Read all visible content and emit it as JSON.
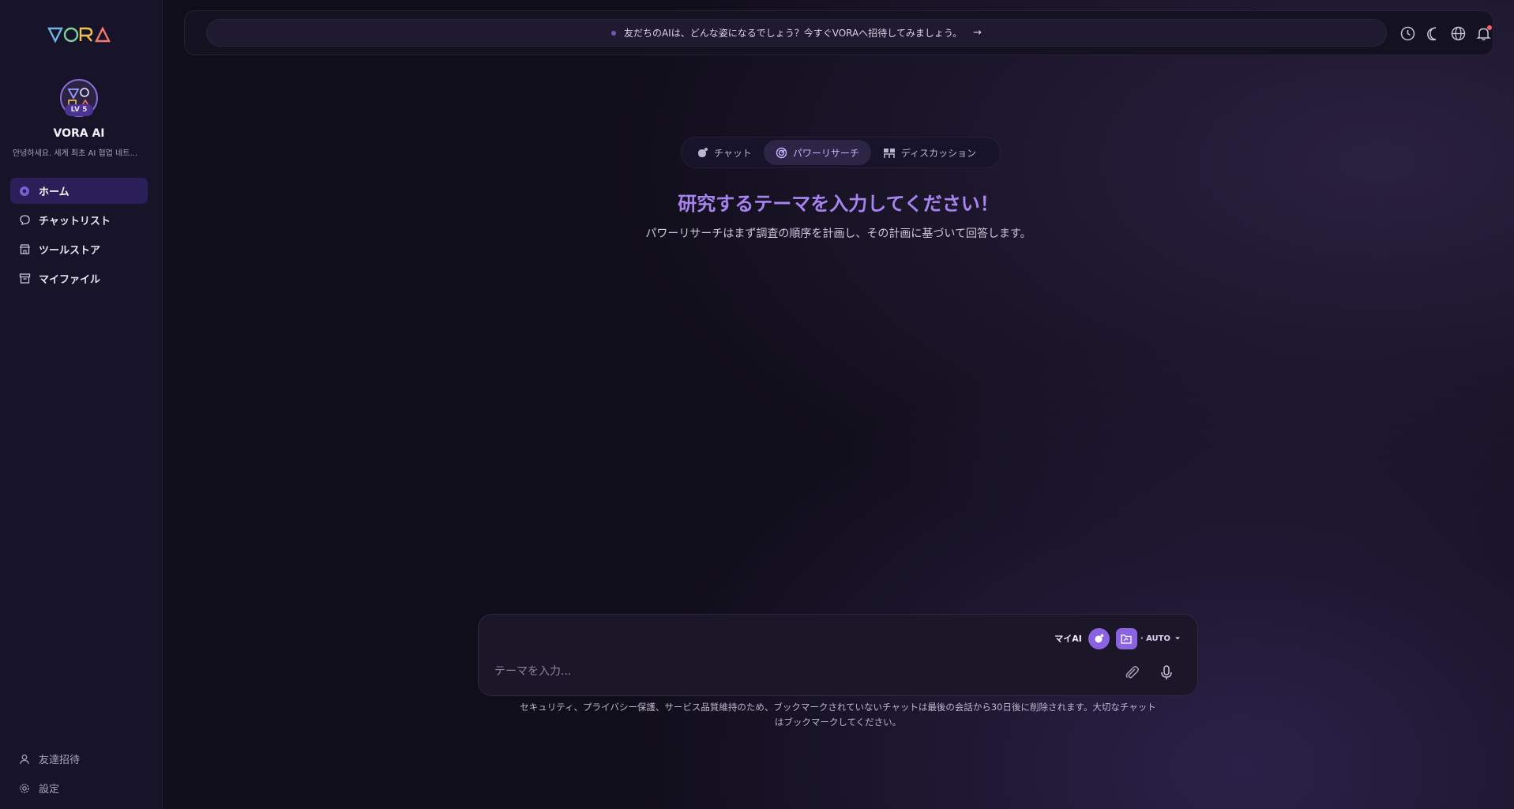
{
  "sidebar": {
    "logo_text": "VORA",
    "profile": {
      "level": "LV 5",
      "name": "VORA AI",
      "description": "안녕하세요. 세계 최초 AI 협업 네트..."
    },
    "items": [
      {
        "label": "ホーム",
        "icon": "home-dot-icon",
        "active": true
      },
      {
        "label": "チャットリスト",
        "icon": "chat-bubble-icon",
        "active": false
      },
      {
        "label": "ツールストア",
        "icon": "store-icon",
        "active": false
      },
      {
        "label": "マイファイル",
        "icon": "archive-icon",
        "active": false
      }
    ],
    "bottom_items": [
      {
        "label": "友達招待",
        "icon": "user-icon"
      },
      {
        "label": "設定",
        "icon": "gear-icon"
      }
    ]
  },
  "header": {
    "announcement": "友だちのAIは、どんな姿になるでしょう？今すぐVORAへ招待してみましょう。",
    "icons": [
      "history-icon",
      "moon-icon",
      "globe-icon",
      "bell-icon"
    ]
  },
  "main": {
    "mode_tabs": [
      {
        "label": "チャット",
        "active": false
      },
      {
        "label": "パワーリサーチ",
        "active": true
      },
      {
        "label": "ディスカッション",
        "active": false
      }
    ],
    "headline": "研究するテーマを入力してください！",
    "subline": "パワーリサーチはまず調査の順序を計画し、その計画に基づいて回答します。",
    "composer": {
      "my_ai_label": "マイAI",
      "model_label": "· AUTO",
      "placeholder": "テーマを入力..."
    },
    "notice_line1": "セキュリティ、プライバシー保護、サービス品質維持のため、ブックマークされていないチャットは最後の会話から30日後に削除されます。大切なチャット",
    "notice_line2": "はブックマークしてください。"
  },
  "colors": {
    "accent": "#a884f0",
    "active_nav": "#2b1f5a",
    "chip": "#8a63e0"
  }
}
